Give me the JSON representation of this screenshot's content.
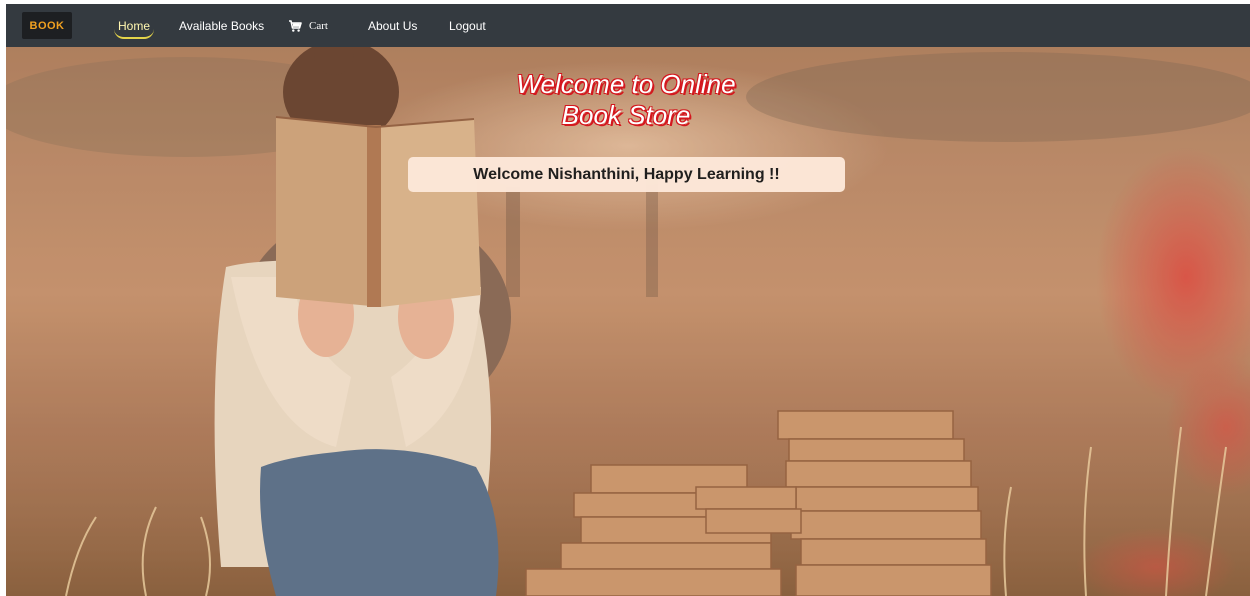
{
  "brand": {
    "logo_text": "BOOK",
    "accent_color": "#f0a020"
  },
  "nav": {
    "home": "Home",
    "available_books": "Available Books",
    "cart": "Cart",
    "about_us": "About Us",
    "logout": "Logout",
    "active": "Home",
    "active_color": "#fff7b0",
    "cart_icon": "cart-icon"
  },
  "hero": {
    "title_line1": "Welcome to Online",
    "title_line2": "Book Store",
    "title_color": "#ffffff",
    "title_shadow_color": "#d4171e",
    "welcome_message": "Welcome Nishanthini, Happy Learning !!",
    "welcome_box_color": "#fde8d9",
    "background_description_icon": "woman-reading-book-photo"
  }
}
